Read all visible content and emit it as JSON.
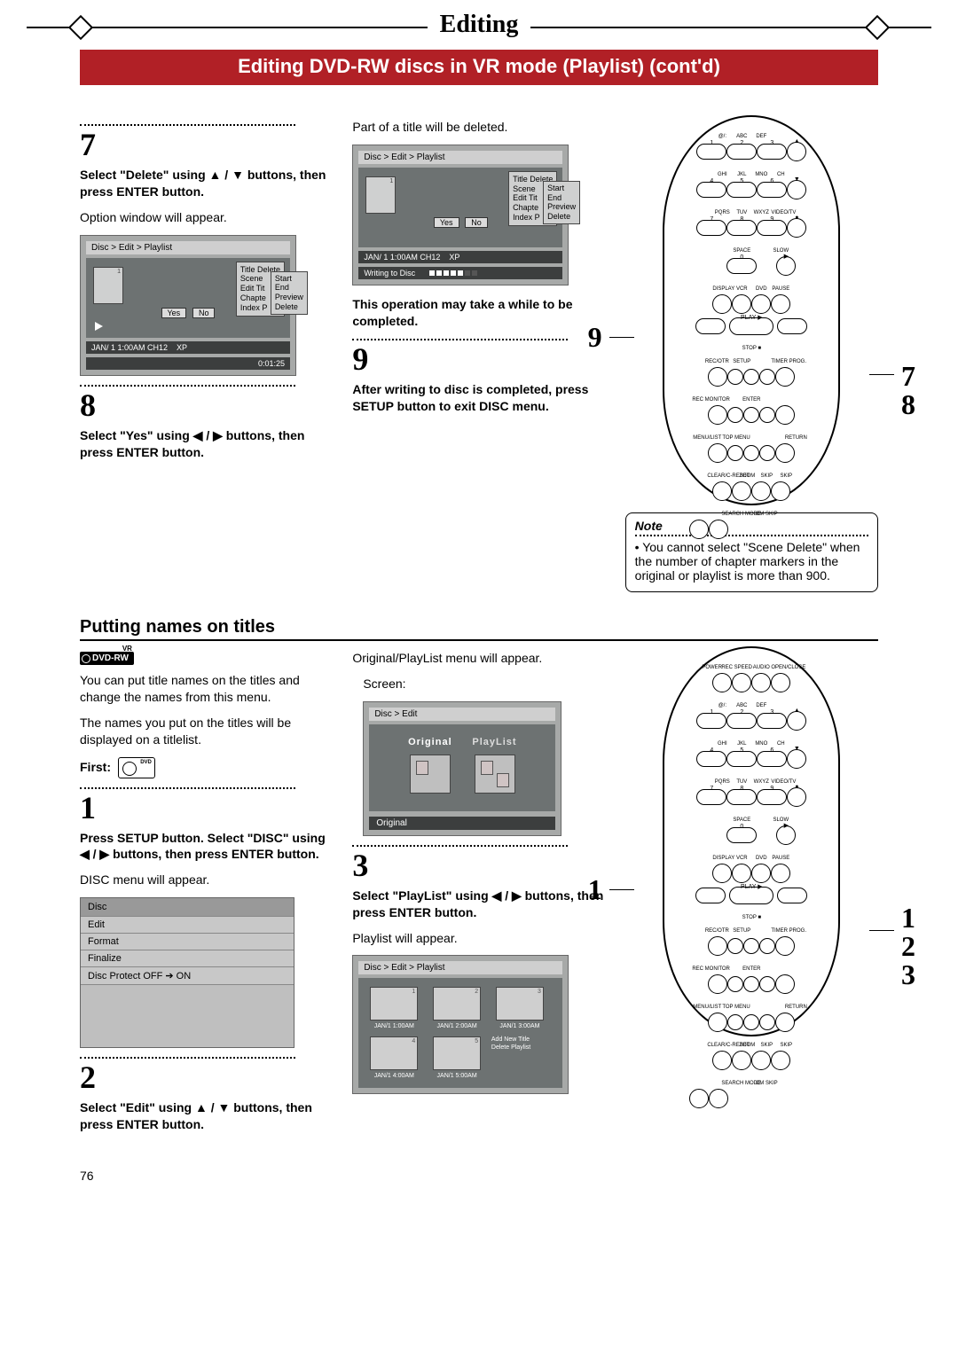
{
  "header": {
    "tab": "Editing",
    "banner": "Editing DVD-RW discs in VR mode (Playlist) (cont'd)"
  },
  "colA": {
    "step7_num": "7",
    "step7_bold": "Select \"Delete\" using ▲ / ▼ buttons, then press ENTER button.",
    "step7_body": "Option window will appear.",
    "step8_num": "8",
    "step8_bold": "Select \"Yes\" using ◀ / ▶ buttons, then press ENTER button.",
    "section": "Putting names on titles",
    "dvdrw_badge": "DVD-RW",
    "dvdrw_vr": "VR",
    "intro1": "You can put title names on the titles and change the names from this menu.",
    "intro2": "The names you put on the titles will be displayed on a titlelist.",
    "first_label": "First:",
    "step1_num": "1",
    "step1_bold": "Press SETUP button. Select \"DISC\" using ◀ / ▶ buttons, then press ENTER button.",
    "step1_body": "DISC menu will appear.",
    "step2_num": "2",
    "step2_bold": "Select \"Edit\" using ▲ / ▼ buttons, then press ENTER button.",
    "disc_menu": {
      "title": "Disc",
      "items": [
        "Edit",
        "Format",
        "Finalize",
        "Disc Protect OFF ➔ ON"
      ]
    },
    "ui7": {
      "crumb": "Disc > Edit > Playlist",
      "thumb_num": "1",
      "popup": [
        "Title Delete",
        "Scene",
        "Edit Tit",
        "Chapte",
        "Index P"
      ],
      "popup_sub": [
        "Start",
        "End",
        "Preview",
        "Delete"
      ],
      "yes": "Yes",
      "no": "No",
      "status_left": "JAN/ 1   1:00AM  CH12",
      "status_mode": "XP",
      "elapsed": "0:01:25"
    }
  },
  "colB": {
    "topline": "Part of a title will be deleted.",
    "ui8": {
      "crumb": "Disc > Edit > Playlist",
      "thumb_num": "1",
      "popup": [
        "Title Delete",
        "Scene",
        "Edit Tit",
        "Chapte",
        "Index P"
      ],
      "popup_sub": [
        "Start",
        "End",
        "Preview",
        "Delete"
      ],
      "yes": "Yes",
      "no": "No",
      "status_left": "JAN/ 1   1:00AM  CH12",
      "status_mode": "XP",
      "writing": "Writing to Disc"
    },
    "warn": "This operation may take a while to be completed.",
    "step9_num": "9",
    "step9_bold": "After writing to disc is completed, press SETUP button to exit DISC menu.",
    "op_intro": "Original/PlayList menu will appear.",
    "op_screen": "Screen:",
    "ui_op": {
      "crumb": "Disc > Edit",
      "left": "Original",
      "right": "PlayList",
      "bottom": "Original"
    },
    "step3_num": "3",
    "step3_bold": "Select \"PlayList\" using ◀ / ▶ buttons, then press ENTER button.",
    "step3_body": "Playlist will appear.",
    "ui_pl": {
      "crumb": "Disc > Edit > Playlist",
      "cells": [
        {
          "n": "1",
          "cap": "JAN/1  1:00AM"
        },
        {
          "n": "2",
          "cap": "JAN/1  2:00AM"
        },
        {
          "n": "3",
          "cap": "JAN/1  3:00AM"
        },
        {
          "n": "4",
          "cap": "JAN/1  4:00AM"
        },
        {
          "n": "5",
          "cap": "JAN/1  5:00AM"
        }
      ],
      "addnew": "Add  New\n        Title\nDelete\n      Playlist"
    }
  },
  "colC": {
    "remote_labels": {
      "r1": [
        "@/:",
        "ABC",
        "DEF",
        ""
      ],
      "n1": [
        "1",
        "2",
        "3",
        "▲"
      ],
      "r2": [
        "GHI",
        "JKL",
        "MNO",
        "CH"
      ],
      "n2": [
        "4",
        "5",
        "6",
        "▼"
      ],
      "r3": [
        "PQRS",
        "TUV",
        "WXYZ",
        "VIDEO/TV"
      ],
      "n3": [
        "7",
        "8",
        "9",
        "●"
      ],
      "r4": [
        "",
        "SPACE",
        "",
        "SLOW"
      ],
      "n4": [
        "",
        "0",
        "",
        "▶"
      ],
      "r5": [
        "DISPLAY",
        "VCR",
        "DVD",
        "PAUSE"
      ],
      "r6": [
        "",
        "◀◀",
        "PLAY ▶",
        "▶▶",
        ""
      ],
      "r7": [
        "",
        "",
        "STOP ■",
        "",
        ""
      ],
      "r8": [
        "REC/OTR",
        "SETUP",
        "",
        "TIMER PROG."
      ],
      "r9": [
        "REC MONITOR",
        "",
        "ENTER",
        "",
        ""
      ],
      "r10": [
        "MENU/LIST",
        "TOP MENU",
        "",
        "RETURN"
      ],
      "r11": [
        "CLEAR/C-RESET",
        "ZOOM",
        "SKIP",
        "SKIP"
      ],
      "r12": [
        "SEARCH MODE",
        "CM SKIP",
        "",
        ""
      ]
    },
    "side_top_left": "9",
    "side_top_right_1": "7",
    "side_top_right_2": "8",
    "side_bot_left": "1",
    "side_bot_right_1": "1",
    "side_bot_right_2": "2",
    "side_bot_right_3": "3",
    "note_title": "Note",
    "note_body": "• You cannot select \"Scene Delete\" when the number of chapter markers in the original or playlist is more than 900.",
    "remote2_labels": {
      "top": [
        "POWER",
        "REC SPEED",
        "AUDIO",
        "OPEN/CLOSE"
      ]
    }
  },
  "page_number": "76"
}
